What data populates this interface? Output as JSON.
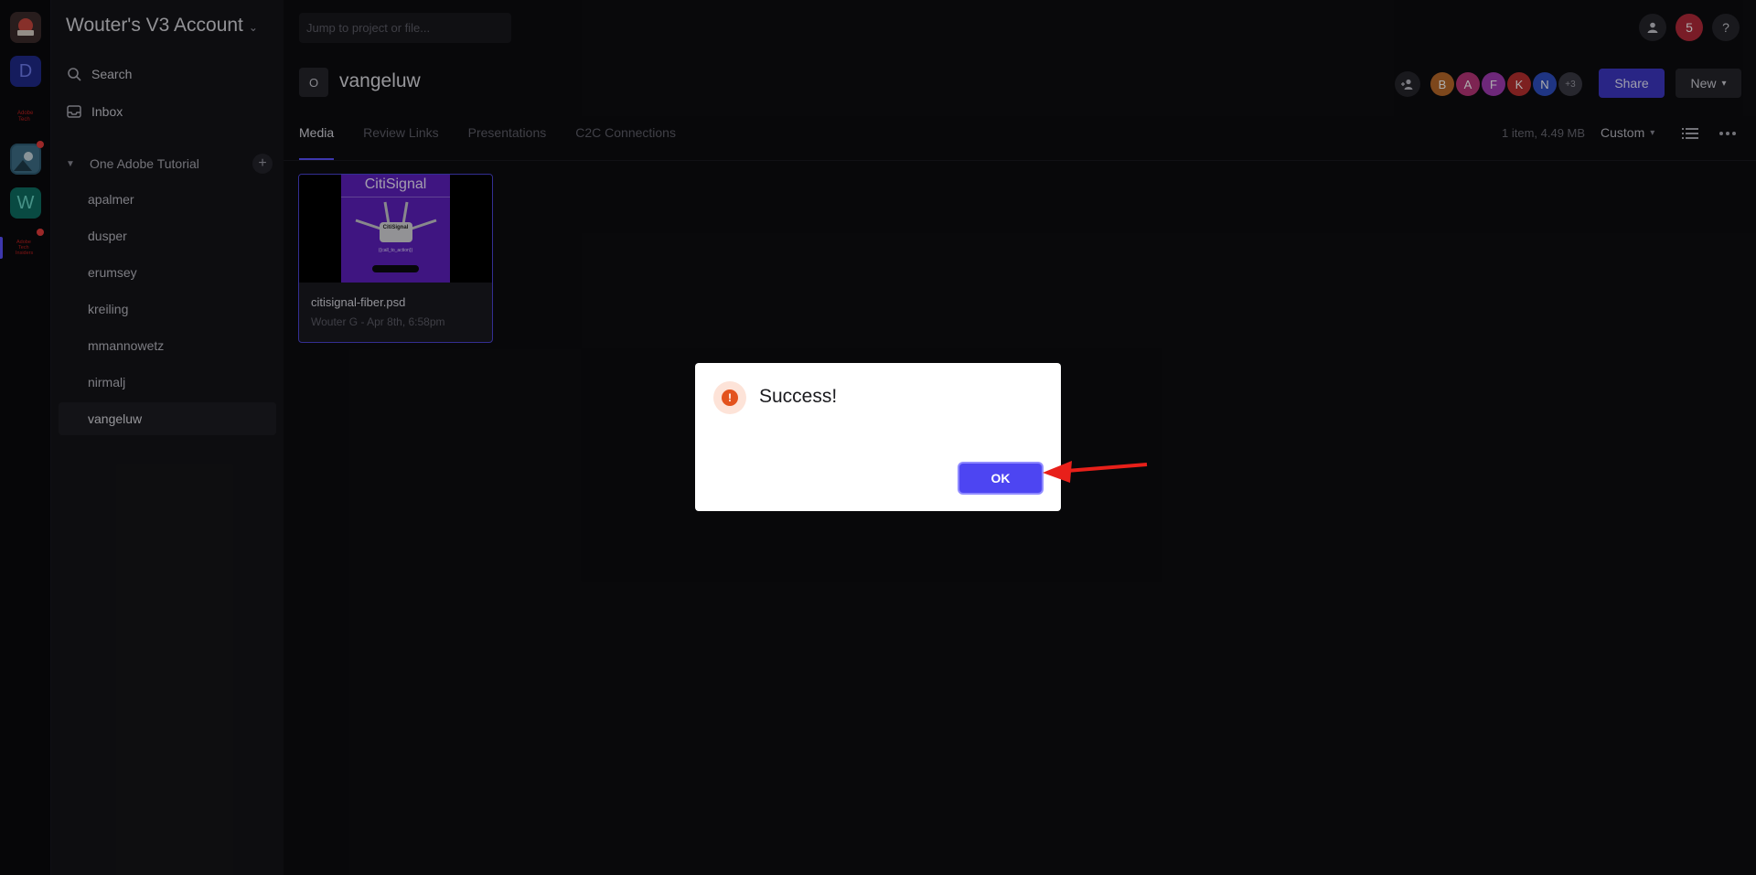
{
  "account": {
    "title": "Wouter's V3 Account"
  },
  "sidebar": {
    "search_label": "Search",
    "inbox_label": "Inbox",
    "team_name": "One Adobe Tutorial",
    "projects": [
      "apalmer",
      "dusper",
      "erumsey",
      "kreiling",
      "mmannowetz",
      "nirmalj",
      "vangeluw"
    ],
    "active_project": "vangeluw"
  },
  "rail": {
    "items": [
      {
        "letter": "D",
        "color": "#1f2a8a"
      },
      {
        "letter": "W",
        "color": "#0e6e62"
      }
    ]
  },
  "topbar": {
    "jump_placeholder": "Jump to project or file...",
    "notification_count": "5",
    "help_label": "?"
  },
  "project": {
    "icon_letter": "O",
    "title": "vangeluw",
    "members": [
      {
        "initial": "B",
        "color": "#b8692a"
      },
      {
        "initial": "A",
        "color": "#b8367a"
      },
      {
        "initial": "F",
        "color": "#a33bb4"
      },
      {
        "initial": "K",
        "color": "#b93030"
      },
      {
        "initial": "N",
        "color": "#2f4fc2"
      }
    ],
    "members_more": "+3",
    "share_label": "Share",
    "new_label": "New"
  },
  "tabs": [
    "Media",
    "Review Links",
    "Presentations",
    "C2C Connections"
  ],
  "active_tab": "Media",
  "listing": {
    "meta": "1 item, 4.49 MB",
    "sort_label": "Custom"
  },
  "asset": {
    "poster_title": "CitiSignal",
    "poster_logo": "CitiSignal",
    "poster_tagline": "{{call_to_action}}",
    "name": "citisignal-fiber.psd",
    "subtitle": "Wouter G - Apr 8th, 6:58pm"
  },
  "dialog": {
    "title": "Success!",
    "ok_label": "OK",
    "accent": "#4d45f2",
    "icon_color": "#e3531e"
  }
}
